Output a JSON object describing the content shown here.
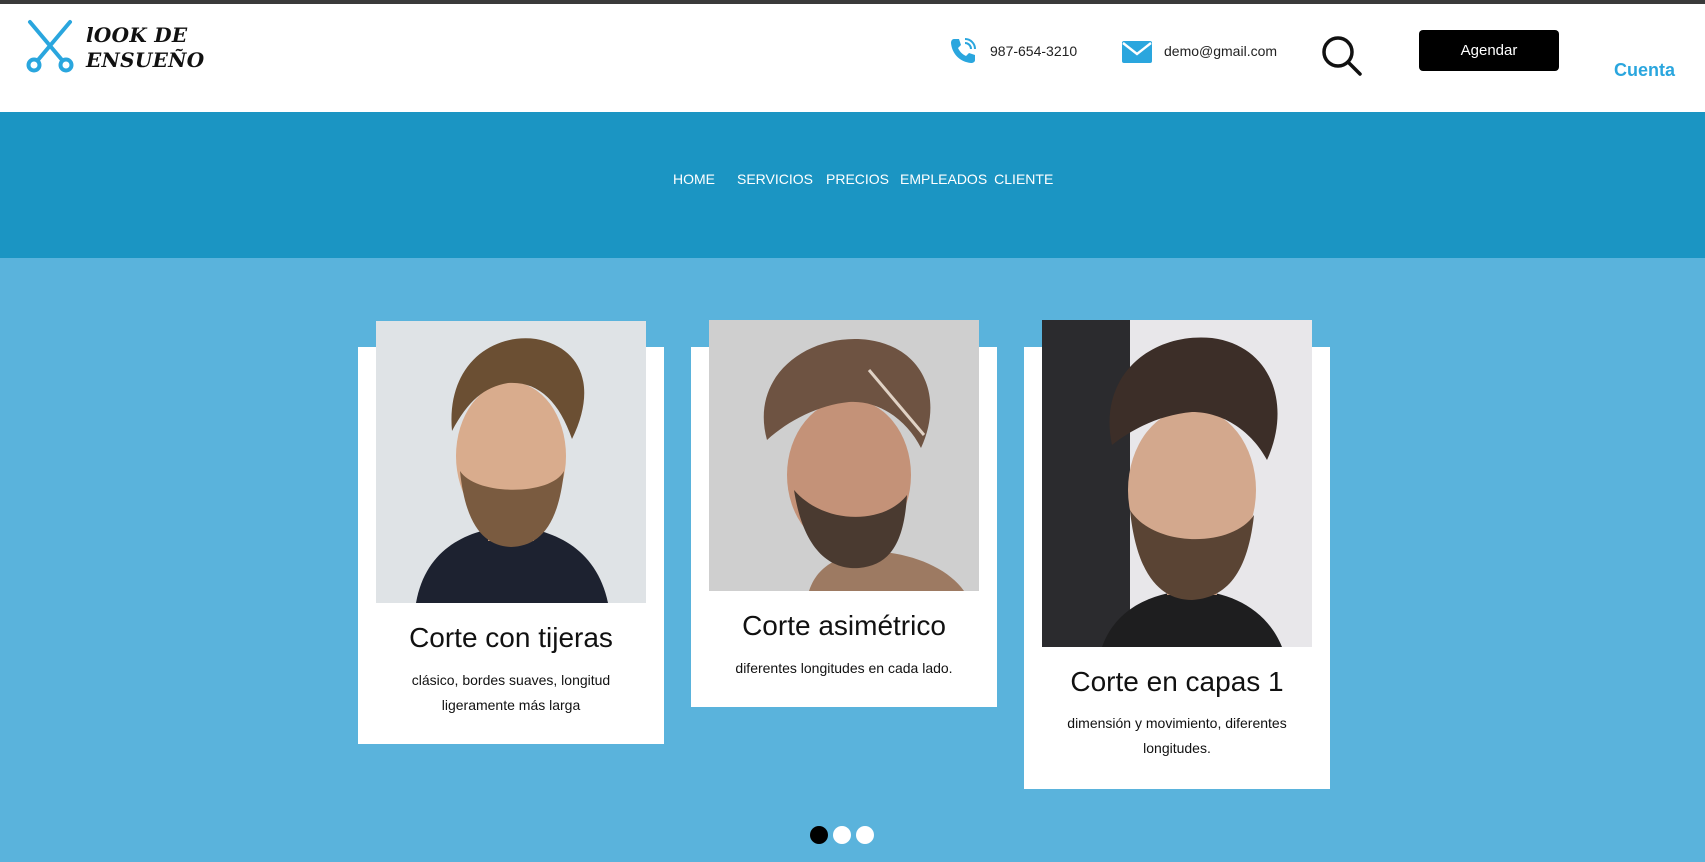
{
  "brand": {
    "line1": "lOOK DE",
    "line2": "ENSUEÑO",
    "icon": "scissors-icon",
    "accent": "#2aa6de"
  },
  "header": {
    "phone": "987-654-3210",
    "phone_icon": "phone-icon",
    "email": "demo@gmail.com",
    "email_icon": "envelope-icon",
    "search_icon": "search-icon",
    "cta_label": "Agendar",
    "account_label": "Cuenta"
  },
  "nav": {
    "background": "#1b95c3",
    "items": [
      {
        "label": "HOME"
      },
      {
        "label": "SERVICIOS"
      },
      {
        "label": "PRECIOS"
      },
      {
        "label": "EMPLEADOS"
      },
      {
        "label": "CLIENTE"
      }
    ]
  },
  "carousel": {
    "background": "#5ab3dc",
    "cards": [
      {
        "title": "Corte con tijeras",
        "description": "clásico, bordes suaves, longitud ligeramente más larga"
      },
      {
        "title": "Corte asimétrico",
        "description": "diferentes longitudes en cada lado."
      },
      {
        "title": "Corte en capas 1",
        "description": "dimensión y movimiento, diferentes longitudes."
      }
    ],
    "dots": {
      "count": 3,
      "active": 1
    }
  }
}
